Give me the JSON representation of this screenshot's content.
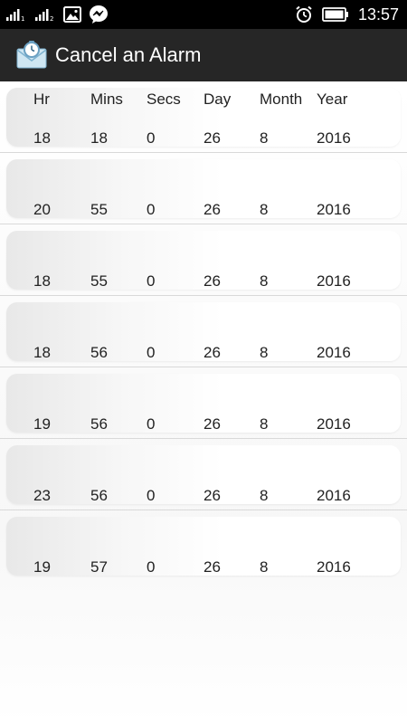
{
  "status_bar": {
    "time": "13:57",
    "left_icons": [
      "signal-icon",
      "signal-2-icon",
      "image-icon",
      "messenger-icon"
    ],
    "right_icons": [
      "alarm-clock-icon",
      "battery-icon"
    ]
  },
  "app_bar": {
    "title": "Cancel an Alarm",
    "icon": "alarm-envelope-icon"
  },
  "table": {
    "headers": [
      "Hr",
      "Mins",
      "Secs",
      "Day",
      "Month",
      "Year"
    ],
    "rows": [
      [
        "18",
        "18",
        "0",
        "26",
        "8",
        "2016"
      ],
      [
        "20",
        "55",
        "0",
        "26",
        "8",
        "2016"
      ],
      [
        "18",
        "55",
        "0",
        "26",
        "8",
        "2016"
      ],
      [
        "18",
        "56",
        "0",
        "26",
        "8",
        "2016"
      ],
      [
        "19",
        "56",
        "0",
        "26",
        "8",
        "2016"
      ],
      [
        "23",
        "56",
        "0",
        "26",
        "8",
        "2016"
      ],
      [
        "19",
        "57",
        "0",
        "26",
        "8",
        "2016"
      ]
    ]
  }
}
